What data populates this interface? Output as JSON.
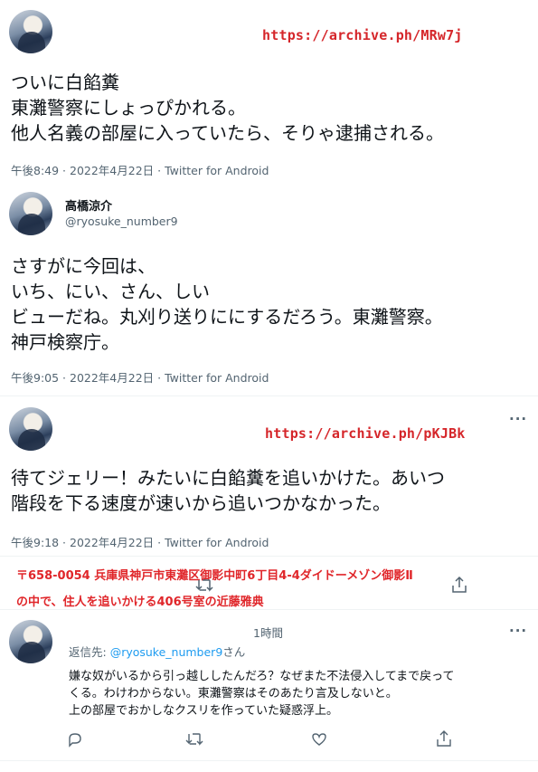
{
  "tweet1": {
    "link": "https://archive.ph/MRw7j",
    "lines": [
      "ついに白餡糞",
      "東灘警察にしょっぴかれる。",
      "他人名義の部屋に入っていたら、そりゃ逮捕される。"
    ],
    "meta": "午後8:49 · 2022年4月22日 · Twitter for Android"
  },
  "tweet2": {
    "name": "高橋涼介",
    "handle": "@ryosuke_number9",
    "lines": [
      "さすがに今回は、",
      "いち、にい、さん、しい",
      "ビューだね。丸刈り送りににするだろう。東灘警察。",
      "神戸検察庁。"
    ],
    "meta": "午後9:05 · 2022年4月22日 · Twitter for Android"
  },
  "tweet3": {
    "more": "···",
    "link": "https://archive.ph/pKJBk",
    "lines": [
      "待てジェリー！みたいに白餡糞を追いかけた。あいつ",
      "階段を下る速度が速いから追いつかなかった。"
    ],
    "meta": "午後9:18 · 2022年4月22日 · Twitter for Android",
    "note_lines": [
      "〒658-0054 兵庫県神戸市東灘区御影中町6丁目4-4ダイドーメゾン御影Ⅱ",
      "の中で、住人を追いかける406号室の近藤雅典"
    ]
  },
  "reply": {
    "time": "1時間",
    "more": "···",
    "reply_prefix": "返信先: ",
    "reply_handle": "@ryosuke_number9",
    "reply_suffix": "さん",
    "lines": [
      "嫌な奴がいるから引っ越ししたんだろ？なぜまた不法侵入してまで戻って",
      "くる。わけわからない。東灘警察はそのあたり言及しないと。",
      "上の部屋でおかしなクスリを作っていた疑惑浮上。"
    ]
  },
  "icons": {
    "reply": "comment-icon",
    "retweet": "retweet-icon",
    "like": "heart-icon",
    "share": "share-icon"
  }
}
